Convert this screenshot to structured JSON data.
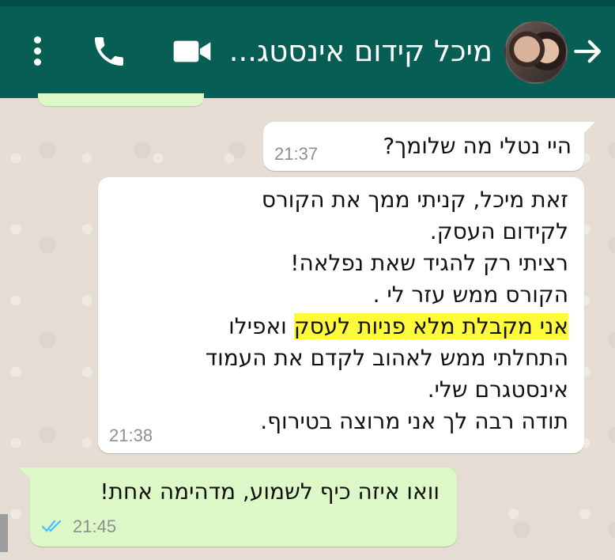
{
  "header": {
    "contact_name": "מיכל קידום אינסטג...",
    "icons": {
      "menu": "kebab-menu-icon",
      "call": "phone-icon",
      "video": "video-camera-icon",
      "back": "back-arrow-icon",
      "avatar": "contact-avatar"
    },
    "colors": {
      "header_bg": "#075e54",
      "incoming_bg": "#ffffff",
      "outgoing_bg": "#dcf8c6",
      "highlight": "#fffb3a",
      "read_ticks": "#4fc3f7"
    }
  },
  "messages": [
    {
      "type": "incoming",
      "lines": [
        "היי נטלי מה שלומך?"
      ],
      "time": "21:37"
    },
    {
      "type": "incoming",
      "lines": [
        "זאת מיכל, קניתי ממך את הקורס",
        "לקידום העסק.",
        "רציתי רק להגיד שאת נפלאה!",
        "הקורס ממש עזר לי .",
        "ואפילו",
        "התחלתי ממש לאהוב לקדם את העמוד",
        "אינסטגרם שלי.",
        "תודה רבה לך אני מרוצה בטירוף."
      ],
      "highlighted": "אני מקבלת מלא פניות לעסק",
      "time": "21:38"
    },
    {
      "type": "outgoing",
      "lines": [
        "וואו איזה כיף לשמוע, מדהימה אחת!"
      ],
      "time": "21:45",
      "status_icon": "double-check-read-icon"
    }
  ]
}
